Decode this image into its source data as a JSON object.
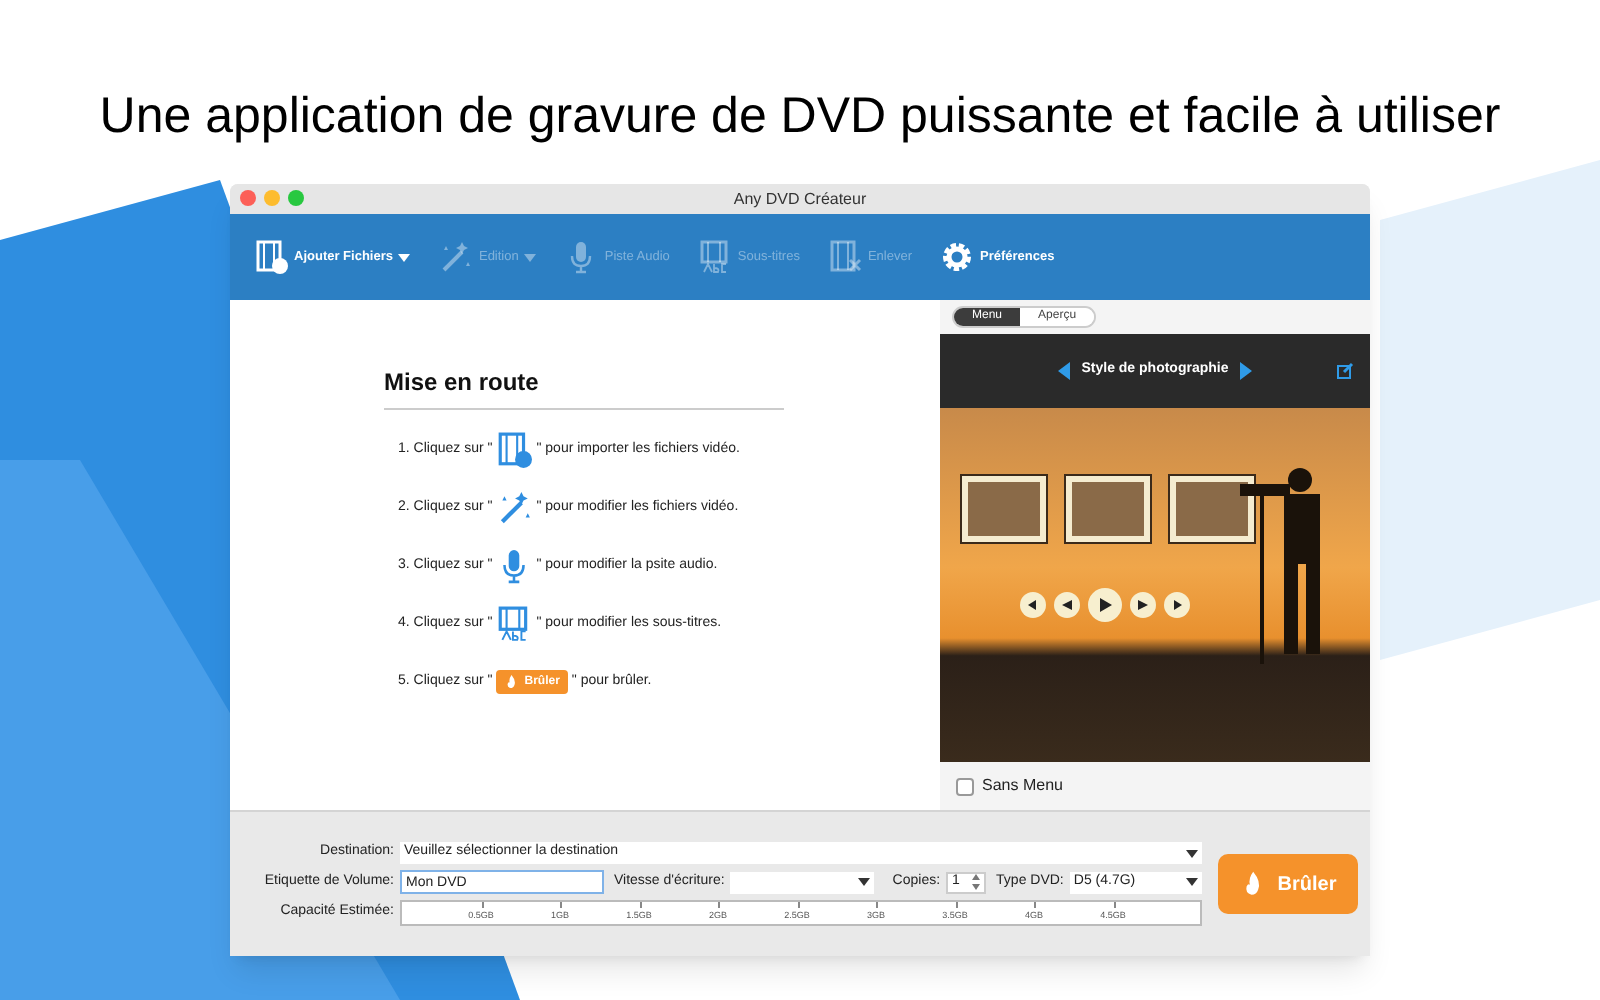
{
  "headline": "Une application de gravure de DVD puissante et facile à utiliser",
  "window": {
    "title": "Any DVD Créateur"
  },
  "toolbar": [
    {
      "label": "Ajouter Fichiers",
      "kind": "add",
      "disabled": false,
      "dropdown": true
    },
    {
      "label": "Edition",
      "kind": "edit",
      "disabled": true,
      "dropdown": true
    },
    {
      "label": "Piste Audio",
      "kind": "audio",
      "disabled": true,
      "dropdown": false
    },
    {
      "label": "Sous-titres",
      "kind": "subtitle",
      "disabled": true,
      "dropdown": false
    },
    {
      "label": "Enlever",
      "kind": "remove",
      "disabled": true,
      "dropdown": false
    },
    {
      "label": "Préférences",
      "kind": "settings",
      "disabled": false,
      "dropdown": false
    }
  ],
  "guide": {
    "title": "Mise en route",
    "steps": [
      {
        "before": "1. Cliquez sur \"",
        "kind": "add",
        "after": "\" pour importer les fichiers vidéo."
      },
      {
        "before": "2. Cliquez sur \"",
        "kind": "edit",
        "after": "\" pour modifier les fichiers vidéo."
      },
      {
        "before": "3. Cliquez sur \"",
        "kind": "audio",
        "after": "\" pour modifier la psite audio."
      },
      {
        "before": "4. Cliquez sur \"",
        "kind": "subtitle",
        "after": "\" pour modifier les sous-titres."
      },
      {
        "before": "5. Cliquez sur \"",
        "kind": "burn",
        "button": "Brûler",
        "after": "\" pour brûler."
      }
    ]
  },
  "preview": {
    "tabs": [
      {
        "label": "Menu",
        "selected": true
      },
      {
        "label": "Aperçu",
        "selected": false
      }
    ],
    "template": "Style de photographie",
    "sans_menu": {
      "label": "Sans Menu",
      "checked": false
    }
  },
  "settings": {
    "destination": {
      "label": "Destination:",
      "value": "Veuillez sélectionner la destination"
    },
    "volume_label": {
      "label": "Etiquette de Volume:",
      "value": "Mon DVD"
    },
    "speed": {
      "label": "Vitesse d'écriture:"
    },
    "copies": {
      "label": "Copies:",
      "value": "1"
    },
    "dvd_type": {
      "label": "Type DVD:",
      "value": "D5 (4.7G)"
    },
    "capacity": {
      "label": "Capacité Estimée:",
      "ticks": [
        "0.5GB",
        "1GB",
        "1.5GB",
        "2GB",
        "2.5GB",
        "3GB",
        "3.5GB",
        "4GB",
        "4.5GB"
      ]
    },
    "burn_button": "Brûler"
  }
}
